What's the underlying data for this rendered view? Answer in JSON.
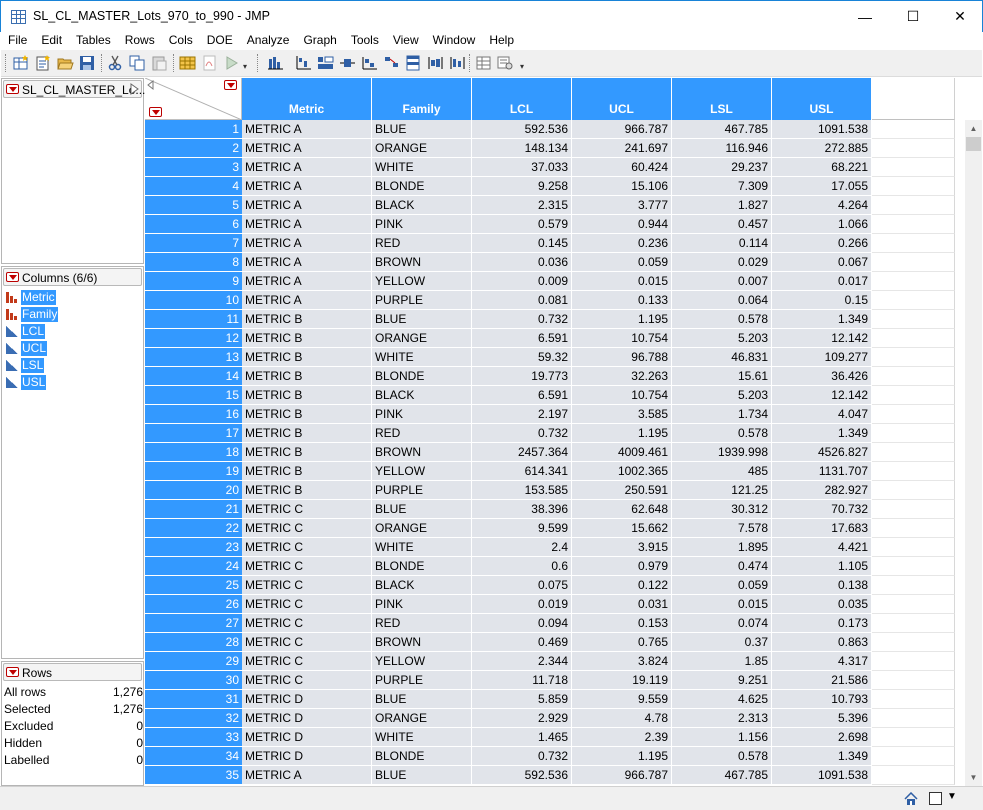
{
  "window": {
    "title": "SL_CL_MASTER_Lots_970_to_990 - JMP",
    "minimize": "—",
    "maximize": "☐",
    "close": "✕"
  },
  "menu": [
    "File",
    "Edit",
    "Tables",
    "Rows",
    "Cols",
    "DOE",
    "Analyze",
    "Graph",
    "Tools",
    "View",
    "Window",
    "Help"
  ],
  "table_panel": {
    "name": "SL_CL_MASTER_Lo..."
  },
  "columns_panel": {
    "title": "Columns (6/6)",
    "items": [
      {
        "name": "Metric",
        "type": "nominal"
      },
      {
        "name": "Family",
        "type": "nominal"
      },
      {
        "name": "LCL",
        "type": "continuous"
      },
      {
        "name": "UCL",
        "type": "continuous"
      },
      {
        "name": "LSL",
        "type": "continuous"
      },
      {
        "name": "USL",
        "type": "continuous"
      }
    ]
  },
  "rows_panel": {
    "title": "Rows",
    "stats": [
      {
        "label": "All rows",
        "value": "1,276"
      },
      {
        "label": "Selected",
        "value": "1,276"
      },
      {
        "label": "Excluded",
        "value": "0"
      },
      {
        "label": "Hidden",
        "value": "0"
      },
      {
        "label": "Labelled",
        "value": "0"
      }
    ]
  },
  "grid": {
    "headers": [
      "Metric",
      "Family",
      "LCL",
      "UCL",
      "LSL",
      "USL"
    ],
    "rows": [
      [
        "1",
        "METRIC A",
        "BLUE",
        "592.536",
        "966.787",
        "467.785",
        "1091.538"
      ],
      [
        "2",
        "METRIC A",
        "ORANGE",
        "148.134",
        "241.697",
        "116.946",
        "272.885"
      ],
      [
        "3",
        "METRIC A",
        "WHITE",
        "37.033",
        "60.424",
        "29.237",
        "68.221"
      ],
      [
        "4",
        "METRIC A",
        "BLONDE",
        "9.258",
        "15.106",
        "7.309",
        "17.055"
      ],
      [
        "5",
        "METRIC A",
        "BLACK",
        "2.315",
        "3.777",
        "1.827",
        "4.264"
      ],
      [
        "6",
        "METRIC A",
        "PINK",
        "0.579",
        "0.944",
        "0.457",
        "1.066"
      ],
      [
        "7",
        "METRIC A",
        "RED",
        "0.145",
        "0.236",
        "0.114",
        "0.266"
      ],
      [
        "8",
        "METRIC A",
        "BROWN",
        "0.036",
        "0.059",
        "0.029",
        "0.067"
      ],
      [
        "9",
        "METRIC A",
        "YELLOW",
        "0.009",
        "0.015",
        "0.007",
        "0.017"
      ],
      [
        "10",
        "METRIC A",
        "PURPLE",
        "0.081",
        "0.133",
        "0.064",
        "0.15"
      ],
      [
        "11",
        "METRIC B",
        "BLUE",
        "0.732",
        "1.195",
        "0.578",
        "1.349"
      ],
      [
        "12",
        "METRIC B",
        "ORANGE",
        "6.591",
        "10.754",
        "5.203",
        "12.142"
      ],
      [
        "13",
        "METRIC B",
        "WHITE",
        "59.32",
        "96.788",
        "46.831",
        "109.277"
      ],
      [
        "14",
        "METRIC B",
        "BLONDE",
        "19.773",
        "32.263",
        "15.61",
        "36.426"
      ],
      [
        "15",
        "METRIC B",
        "BLACK",
        "6.591",
        "10.754",
        "5.203",
        "12.142"
      ],
      [
        "16",
        "METRIC B",
        "PINK",
        "2.197",
        "3.585",
        "1.734",
        "4.047"
      ],
      [
        "17",
        "METRIC B",
        "RED",
        "0.732",
        "1.195",
        "0.578",
        "1.349"
      ],
      [
        "18",
        "METRIC B",
        "BROWN",
        "2457.364",
        "4009.461",
        "1939.998",
        "4526.827"
      ],
      [
        "19",
        "METRIC B",
        "YELLOW",
        "614.341",
        "1002.365",
        "485",
        "1131.707"
      ],
      [
        "20",
        "METRIC B",
        "PURPLE",
        "153.585",
        "250.591",
        "121.25",
        "282.927"
      ],
      [
        "21",
        "METRIC C",
        "BLUE",
        "38.396",
        "62.648",
        "30.312",
        "70.732"
      ],
      [
        "22",
        "METRIC C",
        "ORANGE",
        "9.599",
        "15.662",
        "7.578",
        "17.683"
      ],
      [
        "23",
        "METRIC C",
        "WHITE",
        "2.4",
        "3.915",
        "1.895",
        "4.421"
      ],
      [
        "24",
        "METRIC C",
        "BLONDE",
        "0.6",
        "0.979",
        "0.474",
        "1.105"
      ],
      [
        "25",
        "METRIC C",
        "BLACK",
        "0.075",
        "0.122",
        "0.059",
        "0.138"
      ],
      [
        "26",
        "METRIC C",
        "PINK",
        "0.019",
        "0.031",
        "0.015",
        "0.035"
      ],
      [
        "27",
        "METRIC C",
        "RED",
        "0.094",
        "0.153",
        "0.074",
        "0.173"
      ],
      [
        "28",
        "METRIC C",
        "BROWN",
        "0.469",
        "0.765",
        "0.37",
        "0.863"
      ],
      [
        "29",
        "METRIC C",
        "YELLOW",
        "2.344",
        "3.824",
        "1.85",
        "4.317"
      ],
      [
        "30",
        "METRIC C",
        "PURPLE",
        "11.718",
        "19.119",
        "9.251",
        "21.586"
      ],
      [
        "31",
        "METRIC D",
        "BLUE",
        "5.859",
        "9.559",
        "4.625",
        "10.793"
      ],
      [
        "32",
        "METRIC D",
        "ORANGE",
        "2.929",
        "4.78",
        "2.313",
        "5.396"
      ],
      [
        "33",
        "METRIC D",
        "WHITE",
        "1.465",
        "2.39",
        "1.156",
        "2.698"
      ],
      [
        "34",
        "METRIC D",
        "BLONDE",
        "0.732",
        "1.195",
        "0.578",
        "1.349"
      ],
      [
        "35",
        "METRIC A",
        "BLUE",
        "592.536",
        "966.787",
        "467.785",
        "1091.538"
      ]
    ]
  },
  "colors": {
    "selection": "#3399ff",
    "cell_selected": "#e1e4ea",
    "accent_red": "#c00000",
    "nominal_icon": "#c23a1a",
    "continuous_icon": "#3a6db3"
  }
}
